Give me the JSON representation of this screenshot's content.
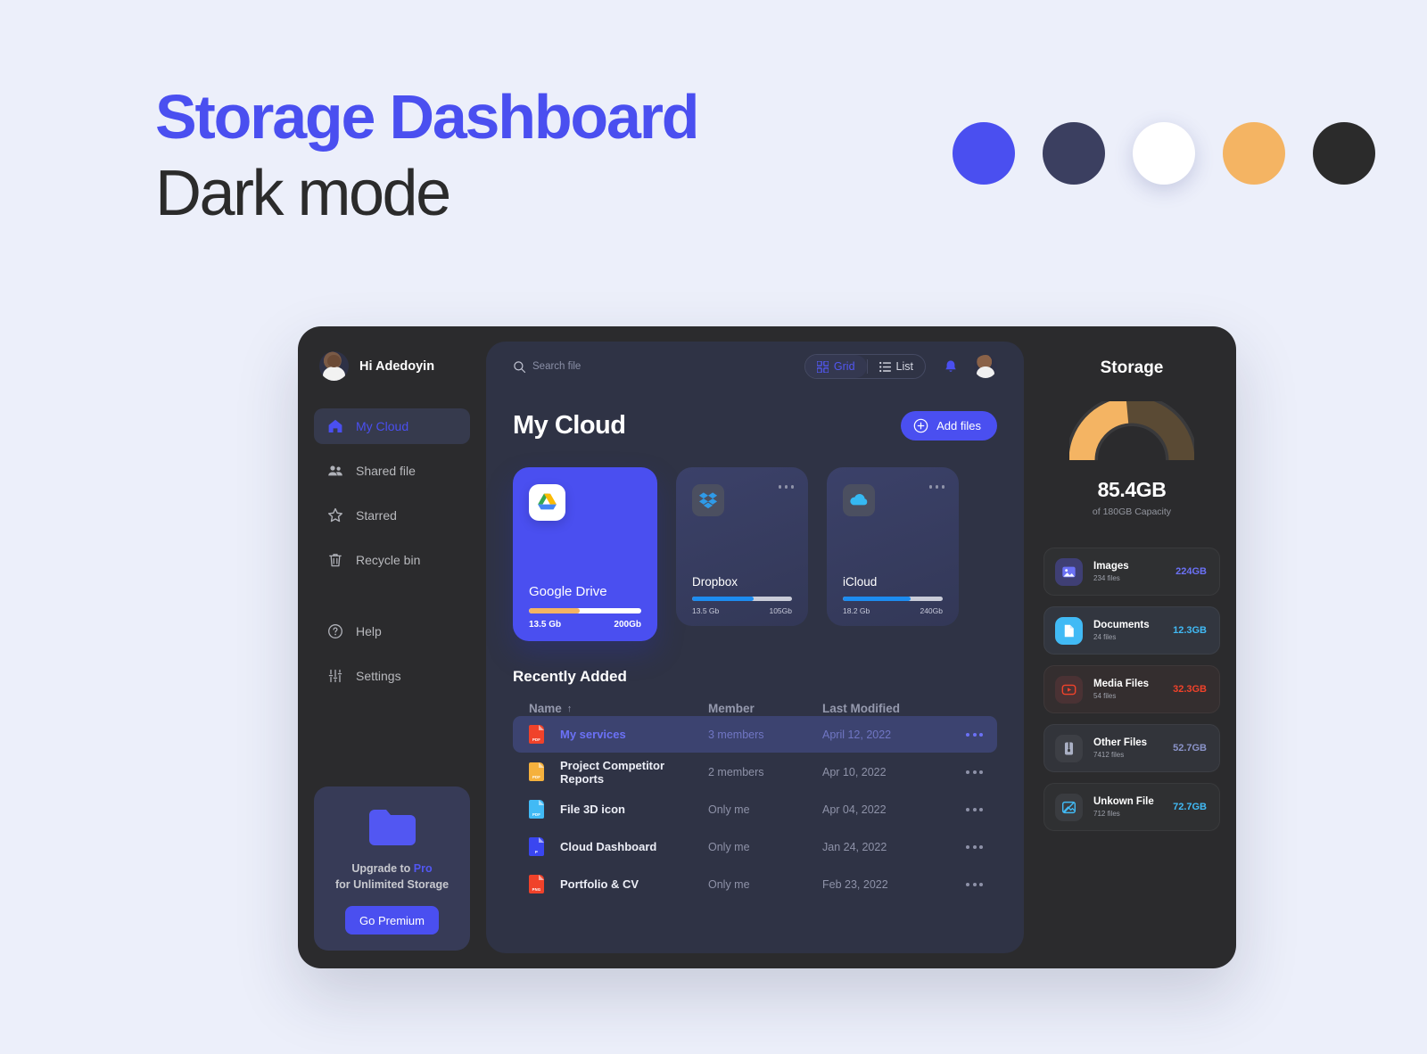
{
  "hero": {
    "title": "Storage Dashboard",
    "subtitle": "Dark mode"
  },
  "palette": [
    {
      "name": "primary-blue",
      "hex": "#4a4ff0"
    },
    {
      "name": "navy",
      "hex": "#3b3f60"
    },
    {
      "name": "white",
      "hex": "#ffffff"
    },
    {
      "name": "orange",
      "hex": "#f4b463"
    },
    {
      "name": "near-black",
      "hex": "#2b2b2b"
    }
  ],
  "sidebar": {
    "greeting": "Hi Adedoyin",
    "items": [
      {
        "label": "My Cloud",
        "icon": "home-icon",
        "active": true
      },
      {
        "label": "Shared file",
        "icon": "people-icon",
        "active": false
      },
      {
        "label": "Starred",
        "icon": "star-icon",
        "active": false
      },
      {
        "label": "Recycle bin",
        "icon": "trash-icon",
        "active": false
      }
    ],
    "secondary_items": [
      {
        "label": "Help",
        "icon": "help-circle-icon"
      },
      {
        "label": "Settings",
        "icon": "sliders-icon"
      }
    ],
    "upgrade": {
      "line1_prefix": "Upgrade to ",
      "line1_accent": "Pro",
      "line2": "for Unlimited Storage",
      "button": "Go Premium"
    }
  },
  "topbar": {
    "search_placeholder": "Search file",
    "search_value": "",
    "view_grid": "Grid",
    "view_list": "List",
    "active_view": "Grid"
  },
  "main": {
    "page_title": "My Cloud",
    "add_files_label": "Add files",
    "cloud_cards": [
      {
        "name": "Google Drive",
        "used": "13.5 Gb",
        "total": "200Gb",
        "percent": 45,
        "bar_color": "#f4b463",
        "track_color": "#ffffff",
        "icon": "google-drive-icon",
        "primary": true
      },
      {
        "name": "Dropbox",
        "used": "13.5 Gb",
        "total": "105Gb",
        "percent": 62,
        "bar_color": "#1d8cf0",
        "track_color": "#c9ccd8",
        "icon": "dropbox-icon",
        "primary": false
      },
      {
        "name": "iCloud",
        "used": "18.2 Gb",
        "total": "240Gb",
        "percent": 68,
        "bar_color": "#1d8cf0",
        "track_color": "#c9ccd8",
        "icon": "icloud-icon",
        "primary": false
      }
    ],
    "recent": {
      "heading": "Recently Added",
      "columns": {
        "name": "Name",
        "member": "Member",
        "modified": "Last Modified"
      },
      "sort_indicator": "↑",
      "rows": [
        {
          "name": "My services",
          "member": "3 members",
          "modified": "April 12, 2022",
          "icon": "pdf-file-icon",
          "icon_color": "#f0422a",
          "icon_label": "PDF",
          "selected": true
        },
        {
          "name": "Project Competitor Reports",
          "member": "2 members",
          "modified": "Apr 10, 2022",
          "icon": "pdf-file-icon",
          "icon_color": "#f5b13d",
          "icon_label": "PDF",
          "selected": false
        },
        {
          "name": "File 3D icon",
          "member": "Only me",
          "modified": "Apr 04, 2022",
          "icon": "pdf-file-icon",
          "icon_color": "#41baf5",
          "icon_label": "PDF",
          "selected": false
        },
        {
          "name": "Cloud Dashboard",
          "member": "Only me",
          "modified": "Jan 24, 2022",
          "icon": "ppt-file-icon",
          "icon_color": "#3a46f0",
          "icon_label": "P",
          "selected": false
        },
        {
          "name": "Portfolio & CV",
          "member": "Only me",
          "modified": "Feb 23, 2022",
          "icon": "png-file-icon",
          "icon_color": "#f0422a",
          "icon_label": "PNG",
          "selected": false
        }
      ]
    }
  },
  "storage": {
    "title": "Storage",
    "used_value": "85.4GB",
    "capacity_text": "of 180GB Capacity",
    "gauge_percent": 47,
    "gauge_fill_color": "#f4b463",
    "gauge_track_color": "#5a4a34",
    "categories": [
      {
        "name": "Images",
        "files": "234 files",
        "size": "224GB",
        "size_color": "#6b71f6",
        "icon": "image-icon",
        "icon_bg": "#3f3f74",
        "icon_color": "#6b71f6",
        "card_bg": "#2f3032"
      },
      {
        "name": "Documents",
        "files": "24 files",
        "size": "12.3GB",
        "size_color": "#41baf5",
        "icon": "document-icon",
        "icon_bg": "#41baf5",
        "icon_color": "#ffffff",
        "card_bg": "#32363f"
      },
      {
        "name": "Media Files",
        "files": "54 files",
        "size": "32.3GB",
        "size_color": "#f0422a",
        "icon": "video-icon",
        "icon_bg": "#4a3234",
        "icon_color": "#f0422a",
        "card_bg": "#342e2f"
      },
      {
        "name": "Other Files",
        "files": "7412 files",
        "size": "52.7GB",
        "size_color": "#8a93c9",
        "icon": "zip-icon",
        "icon_bg": "#3d3f45",
        "icon_color": "#aab0c4",
        "card_bg": "#32343a"
      },
      {
        "name": "Unkown File",
        "files": "712 files",
        "size": "72.7GB",
        "size_color": "#41baf5",
        "icon": "broken-image-icon",
        "icon_bg": "#3a3c40",
        "icon_color": "#41baf5",
        "card_bg": "#2f3032"
      }
    ]
  }
}
